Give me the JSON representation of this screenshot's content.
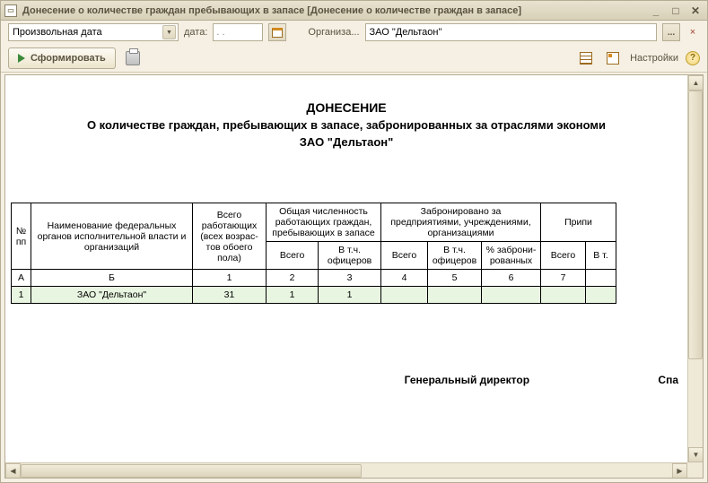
{
  "window": {
    "title": "Донесение о количестве граждан пребывающих в запасе [Донесение о количестве граждан в запасе]"
  },
  "form": {
    "period_label": "Произвольная дата",
    "date_label": "дата:",
    "date_value": " . .",
    "org_label": "Организа...",
    "org_value": "ЗАО \"Дельтаон\"",
    "select_btn": "..."
  },
  "toolbar": {
    "form_btn": "Сформировать",
    "settings_label": "Настройки"
  },
  "report": {
    "title1": "ДОНЕСЕНИЕ",
    "title2": "О количестве граждан, пребывающих в запасе, забронированных за отраслями экономи",
    "title3": "ЗАО \"Дельтаон\"",
    "headers": {
      "npp": "№ пп",
      "name": "Наименование федеральных органов исполнительной власти и организаций",
      "total_work": "Всего работающих (всех возрас-тов обоего пола)",
      "in_reserve": "Общая численность работающих граждан, пребывающих в запасе",
      "booked": "Забронировано за предприятиями, учреждениями, организациями",
      "pripis": "Припи",
      "vsego": "Всего",
      "officers": "В т.ч. офицеров",
      "percent": "% заброни-рованных",
      "vt": "В т."
    },
    "colnums": {
      "a": "А",
      "b": "Б",
      "c1": "1",
      "c2": "2",
      "c3": "3",
      "c4": "4",
      "c5": "5",
      "c6": "6",
      "c7": "7"
    },
    "rows": [
      {
        "n": "1",
        "name": "ЗАО \"Дельтаон\"",
        "total": "31",
        "r_total": "1",
        "r_of": "1",
        "b_total": "",
        "b_of": "",
        "b_pct": "",
        "p_total": "",
        "p_vt": ""
      }
    ],
    "sig_role": "Генеральный директор",
    "sig_name": "Спа"
  }
}
